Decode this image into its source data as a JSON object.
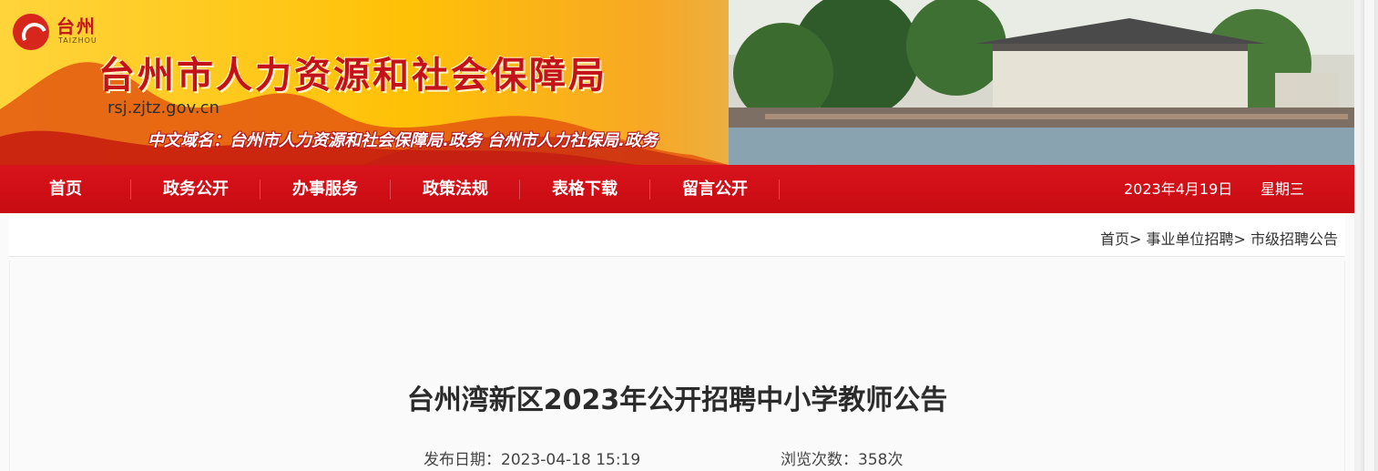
{
  "banner": {
    "logo_cn": "台州",
    "logo_en": "TAIZHOU",
    "title": "台州市人力资源和社会保障局",
    "domain": "rsj.zjtz.gov.cn",
    "cn_domain": "中文域名：台州市人力资源和社会保障局.政务    台州市人力社保局.政务"
  },
  "nav": {
    "items": [
      "首页",
      "政务公开",
      "办事服务",
      "政策法规",
      "表格下载",
      "留言公开"
    ],
    "date": "2023年4月19日",
    "weekday": "星期三"
  },
  "breadcrumb": {
    "home": "首页",
    "sep": ">",
    "level1": "事业单位招聘",
    "level2": "市级招聘公告"
  },
  "article": {
    "title": "台州湾新区2023年公开招聘中小学教师公告",
    "published": "发布日期：2023-04-18 15:19",
    "views": "浏览次数：358次"
  },
  "colors": {
    "nav_red": "#d9131b",
    "title_red": "#c4121a"
  }
}
